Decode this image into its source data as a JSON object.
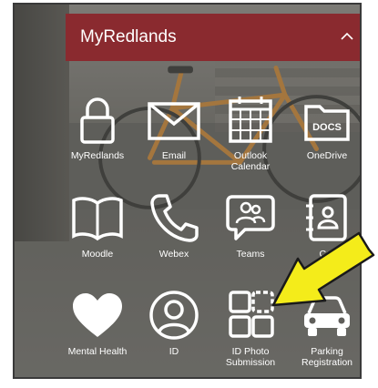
{
  "header": {
    "title": "MyRedlands",
    "chevron_icon": "chevron-up-icon"
  },
  "apps": [
    {
      "label": "MyRedlands",
      "icon": "lock-icon"
    },
    {
      "label": "Email",
      "icon": "envelope-icon"
    },
    {
      "label": "Outlook\nCalendar",
      "icon": "calendar-icon"
    },
    {
      "label": "OneDrive",
      "icon": "docs-folder-icon"
    },
    {
      "label": "Moodle",
      "icon": "book-icon"
    },
    {
      "label": "Webex",
      "icon": "phone-icon"
    },
    {
      "label": "Teams",
      "icon": "teams-chat-icon"
    },
    {
      "label": "Car",
      "icon": "contacts-book-icon"
    },
    {
      "label": "Mental Health",
      "icon": "heart-icon"
    },
    {
      "label": "ID",
      "icon": "user-circle-icon"
    },
    {
      "label": "ID Photo\nSubmission",
      "icon": "photo-grid-icon"
    },
    {
      "label": "Parking\nRegistration",
      "icon": "car-icon"
    }
  ],
  "annotation": {
    "icon": "yellow-arrow-pointer",
    "color": "#f4ec1a"
  },
  "colors": {
    "header_bg": "#8a2a2f",
    "icon_color": "#ffffff"
  }
}
